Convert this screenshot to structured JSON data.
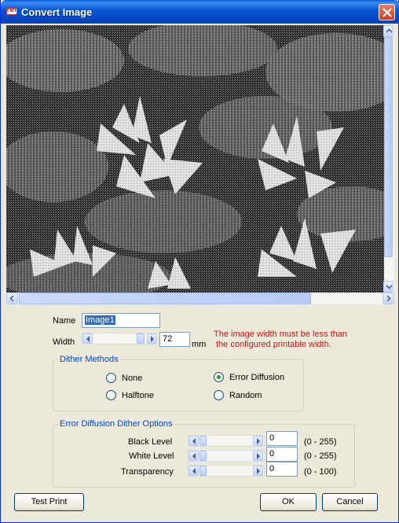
{
  "window": {
    "title": "Convert Image",
    "title_icon_text": "FMT"
  },
  "form": {
    "name_label": "Name",
    "name_value": "Image1",
    "width_label": "Width",
    "width_value": "72",
    "width_unit": "mm",
    "warning_line1": "The image width must be less than",
    "warning_line2": "the configured printable width."
  },
  "dither_methods": {
    "title": "Dither Methods",
    "options": [
      {
        "label": "None",
        "selected": false
      },
      {
        "label": "Error Diffusion",
        "selected": true
      },
      {
        "label": "Halftone",
        "selected": false
      },
      {
        "label": "Random",
        "selected": false
      }
    ]
  },
  "error_diffusion": {
    "title": "Error Diffusion Dither Options",
    "rows": [
      {
        "label": "Black Level",
        "value": "0",
        "range": "(0 - 255)"
      },
      {
        "label": "White Level",
        "value": "0",
        "range": "(0 - 255)"
      },
      {
        "label": "Transparency",
        "value": "0",
        "range": "(0 - 100)"
      }
    ]
  },
  "buttons": {
    "test_print": "Test Print",
    "ok": "OK",
    "cancel": "Cancel"
  },
  "colors": {
    "title_bar": "#0b58d6",
    "warning": "#cc1414",
    "group_title": "#0046d5",
    "dialog_bg": "#ece9d8"
  }
}
